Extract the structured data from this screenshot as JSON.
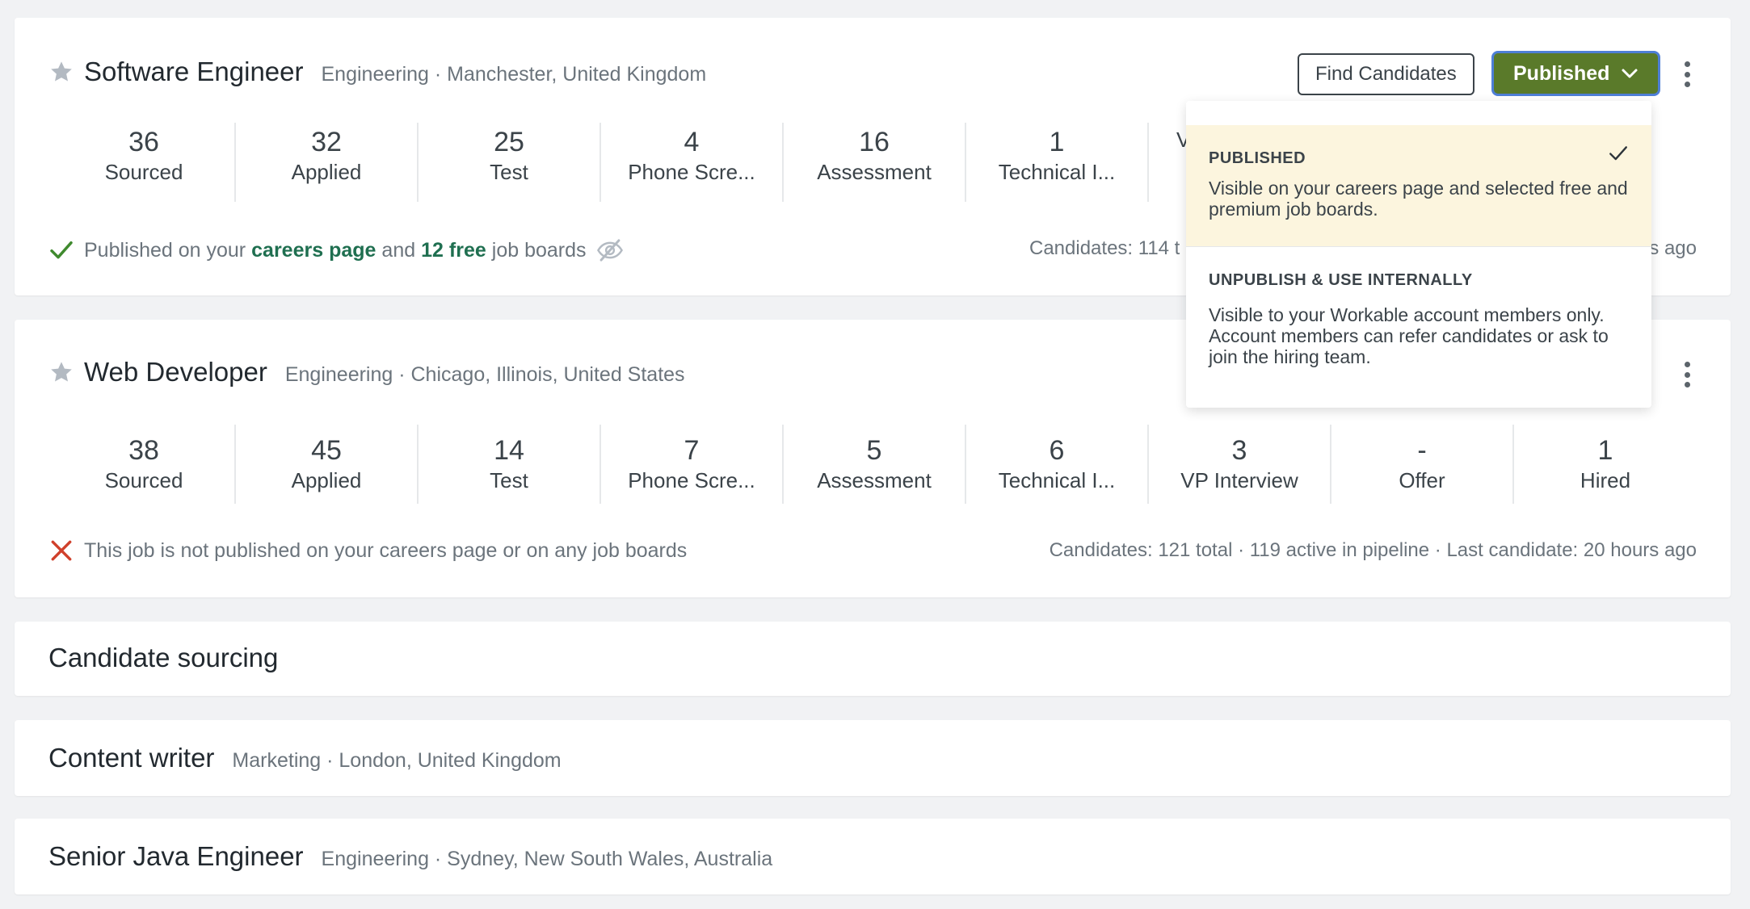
{
  "jobs": [
    {
      "title": "Software Engineer",
      "meta": "Engineering · Manchester, United Kingdom",
      "stages": [
        {
          "count": "36",
          "name": "Sourced"
        },
        {
          "count": "32",
          "name": "Applied"
        },
        {
          "count": "25",
          "name": "Test"
        },
        {
          "count": "4",
          "name": "Phone Scre..."
        },
        {
          "count": "16",
          "name": "Assessment"
        },
        {
          "count": "1",
          "name": "Technical I..."
        },
        {
          "count": "",
          "name": "V"
        }
      ],
      "status": {
        "prefix": "Published on your",
        "link1": "careers page",
        "middle": "and",
        "link2": "12 free",
        "suffix": "job boards"
      },
      "candidates_left": "Candidates: 114 t",
      "candidates_right": "s ago",
      "find_candidates_label": "Find Candidates",
      "published_label": "Published"
    },
    {
      "title": "Web Developer",
      "meta": "Engineering · Chicago, Illinois, United States",
      "stages": [
        {
          "count": "38",
          "name": "Sourced"
        },
        {
          "count": "45",
          "name": "Applied"
        },
        {
          "count": "14",
          "name": "Test"
        },
        {
          "count": "7",
          "name": "Phone Scre..."
        },
        {
          "count": "5",
          "name": "Assessment"
        },
        {
          "count": "6",
          "name": "Technical I..."
        },
        {
          "count": "3",
          "name": "VP Interview"
        },
        {
          "count": "-",
          "name": "Offer"
        },
        {
          "count": "1",
          "name": "Hired"
        }
      ],
      "status_text": "This job is not published on your careers page or on any job boards",
      "candidates": "Candidates: 121 total · 119 active in pipeline · Last candidate: 20 hours ago"
    }
  ],
  "sections": [
    {
      "title": "Candidate sourcing"
    },
    {
      "title": "Content writer",
      "meta": "Marketing · London, United Kingdom"
    },
    {
      "title": "Senior Java Engineer",
      "meta": "Engineering · Sydney, New South Wales, Australia"
    }
  ],
  "dropdown": {
    "options": [
      {
        "heading": "PUBLISHED",
        "description": "Visible on your careers page and selected free and premium job boards.",
        "selected": true
      },
      {
        "heading": "UNPUBLISH & USE INTERNALLY",
        "description": "Visible to your Workable account members only. Account members can refer candidates or ask to join the hiring team.",
        "selected": false
      }
    ]
  },
  "colors": {
    "published_button": "#5a7a2a",
    "focus_ring": "#4e7fd6",
    "link_green": "#1f6f50",
    "check_green": "#3f8a2e",
    "error_red": "#d0402b",
    "selected_option_bg": "#fcf5de"
  },
  "icons": {
    "star": "star-icon",
    "check": "check-icon",
    "cross": "cross-icon",
    "eye_off": "eye-off-icon",
    "chevron": "chevron-down-icon",
    "kebab": "more-vertical-icon"
  }
}
